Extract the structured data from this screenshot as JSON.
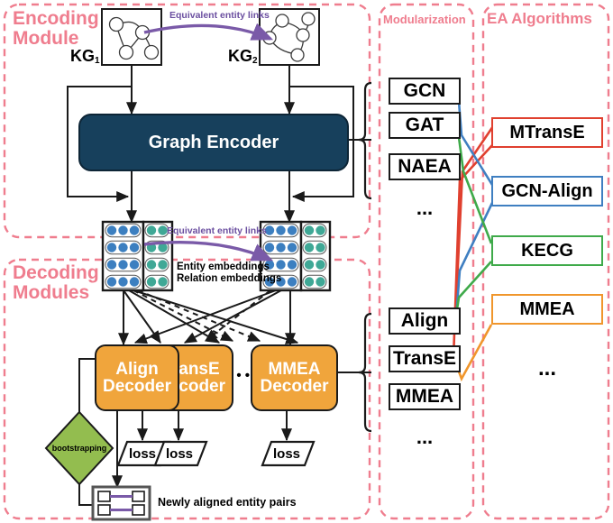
{
  "panels": [
    {
      "id": "encoding",
      "title": "Encoding\nModule",
      "title_line1": "Encoding",
      "title_line2": "Module"
    },
    {
      "id": "decoding",
      "title": "Decoding\nModules",
      "title_line1": "Decoding",
      "title_line2": "Modules"
    },
    {
      "id": "modularization",
      "title": "Modularization"
    },
    {
      "id": "ea",
      "title": "EA Algorithms"
    }
  ],
  "encoding": {
    "kg1_label": "KG",
    "kg1_sub": "1",
    "kg2_label": "KG",
    "kg2_sub": "2",
    "link_label_top": "Equivalent entity links",
    "link_label_mid": "Equivalent entity links",
    "encoder_label": "Graph Encoder",
    "kg1_nodes": 4,
    "kg2_nodes": 5
  },
  "embeddings": {
    "entity_caption": "Entity embeddings",
    "relation_caption": "Relation embeddings",
    "rows": 4,
    "entity_cols": 3,
    "relation_cols": 2,
    "entity_color": "#3c7fc0",
    "relation_color": "#3fa896"
  },
  "decoding": {
    "decoders": [
      {
        "name": "align-decoder",
        "line1": "Align",
        "line2": "Decoder"
      },
      {
        "name": "transe-decoder",
        "line1": "TransE",
        "line2": "Decoder"
      },
      {
        "name": "mmea-decoder",
        "line1": "MMEA",
        "line2": "Decoder"
      }
    ],
    "ellipsis": "•  •  •",
    "bootstrapping_label": "bootstrapping",
    "loss_labels": [
      "loss",
      "loss",
      "loss"
    ],
    "newly_aligned_caption": "Newly aligned entity pairs",
    "decoder_fill": "#f0a53c",
    "bootstrap_fill": "#93bd4f"
  },
  "modularization": {
    "title": "Modularization",
    "encoder_group": {
      "items": [
        "GCN",
        "GAT",
        "NAEA"
      ],
      "ellipsis": "..."
    },
    "decoder_group": {
      "items": [
        "Align",
        "TransE",
        "MMEA"
      ],
      "ellipsis": "..."
    }
  },
  "ea_algorithms": {
    "title": "EA Algorithms",
    "items": [
      {
        "label": "MTransE",
        "color": "#e0402f"
      },
      {
        "label": "GCN-Align",
        "color": "#3f7fc1"
      },
      {
        "label": "KECG",
        "color": "#3faa4a"
      },
      {
        "label": "MMEA",
        "color": "#f0962c"
      }
    ],
    "ellipsis": "..."
  },
  "colors": {
    "panel_border": "#ef7d8e",
    "panel_title": "#ef7d8e",
    "encoder_fill": "#17405c",
    "link_purple": "#7a5aa8",
    "stroke": "#1a1a1a"
  }
}
